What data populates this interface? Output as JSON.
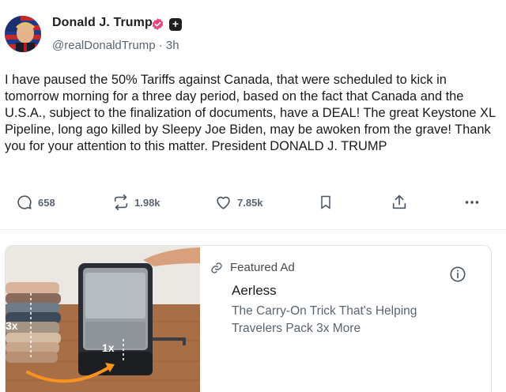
{
  "post": {
    "author_name": "Donald J. Trump",
    "handle": "@realDonaldTrump",
    "separator": "·",
    "time_ago": "3h",
    "verified_icon": "verified-badge-icon",
    "plus_icon": "follow-plus-icon",
    "text": "I have paused the 50% Tariffs against Canada, that were scheduled to kick in tomorrow morning for a three day period, based on the fact that Canada and the U.S.A., subject to the finalization of documents, have a DEAL! The great Keystone XL Pipeline, long ago killed by Sleepy Joe Biden, may be awoken from the grave! Thank you for your attention to this matter. President DONALD J. TRUMP"
  },
  "actions": {
    "replies": {
      "icon": "reply-icon",
      "count": "658"
    },
    "retruths": {
      "icon": "retruth-icon",
      "count": "1.98k"
    },
    "likes": {
      "icon": "heart-icon",
      "count": "7.85k"
    },
    "bookmark": {
      "icon": "bookmark-icon"
    },
    "share": {
      "icon": "share-icon"
    },
    "more": {
      "icon": "more-icon"
    }
  },
  "ad": {
    "label": "Featured Ad",
    "brand": "Aerless",
    "headline": "The Carry-On Trick That's Helping Travelers Pack 3x More",
    "image_labels": {
      "left": "3x",
      "right": "1x"
    },
    "icons": {
      "link": "link-icon",
      "info": "info-icon"
    }
  },
  "colors": {
    "verified_pink": "#e8467c",
    "muted_text": "#5b6570",
    "divider": "#ececec",
    "orange_arrow": "#f7931e"
  }
}
